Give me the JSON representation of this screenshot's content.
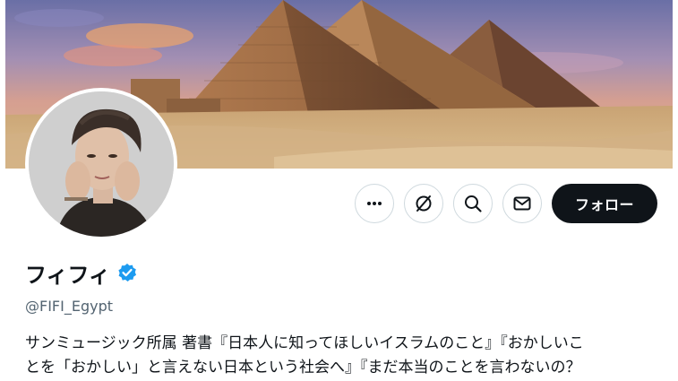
{
  "profile": {
    "display_name": "フィフィ",
    "handle": "@FIFI_Egypt",
    "bio_lines": [
      "サンミュージック所属 著書『日本人に知ってほしいイスラムのこと』『おかしいこ",
      "とを「おかしい」と言えない日本という社会へ』『まだ本当のことを言わないの？"
    ],
    "verified_color": "#1d9bf0"
  },
  "actions": {
    "follow_label": "フォロー",
    "more_icon": "more-horizontal-icon",
    "grok_icon": "grok-icon",
    "search_icon": "search-icon",
    "message_icon": "envelope-icon"
  },
  "banner": {
    "subject": "pyramids-of-giza"
  }
}
